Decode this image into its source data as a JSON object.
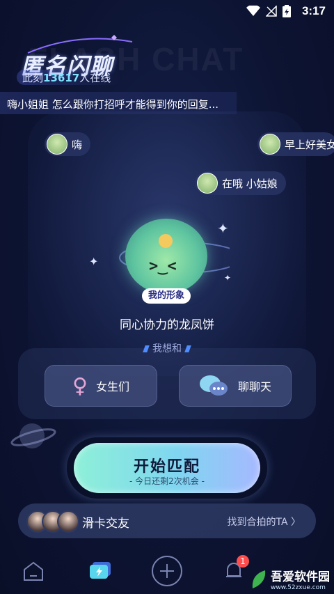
{
  "status_bar": {
    "time": "3:17"
  },
  "header": {
    "bg_text": "FLASH CHAT",
    "logo": "匿名闪聊",
    "online_prefix": "此刻",
    "online_count": "13617",
    "online_suffix": "人在线"
  },
  "ticker": {
    "text": "嗨小姐姐 怎么跟你打招呼才能得到你的回复..."
  },
  "bubbles": [
    {
      "text": "嗨"
    },
    {
      "text": "早上好美女"
    },
    {
      "text": "在哦 小姑娘"
    }
  ],
  "avatar": {
    "tag": "我的形象",
    "face": ">‿<",
    "name": "同心协力的龙凤饼"
  },
  "preference": {
    "title": "我想和",
    "options": [
      {
        "label": "女生们",
        "icon": "venus-icon"
      },
      {
        "label": "聊聊天",
        "icon": "chat-bubbles-icon"
      }
    ]
  },
  "start": {
    "label": "开始匹配",
    "sub": "- 今日还剩2次机会 -"
  },
  "swipe_card": {
    "title": "滑卡交友",
    "link": "找到合拍的TA"
  },
  "tabbar": {
    "badge": "1"
  },
  "watermark": {
    "text": "吾爱软件园",
    "url": "www.52zxue.com"
  },
  "colors": {
    "accent": "#7fe3ff",
    "start_gradient_start": "#8ef0d8",
    "start_gradient_end": "#a6b8ff",
    "background": "#0d1433"
  }
}
